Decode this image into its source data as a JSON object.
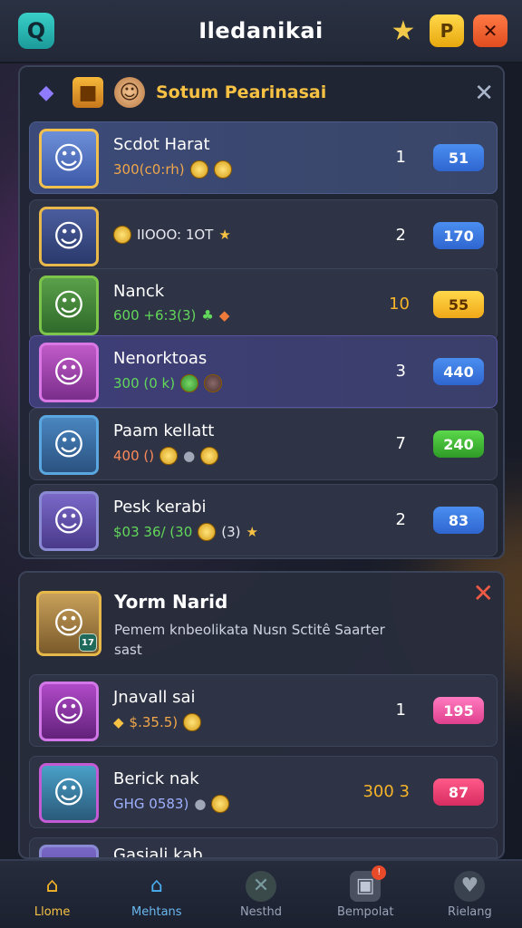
{
  "header": {
    "title": "Iledanikai",
    "logo_glyph": "Q",
    "coin_glyph": "P",
    "close_glyph": "✕"
  },
  "panel_a": {
    "title": "Sotum Pearinasai",
    "rows": [
      {
        "name": "Scdot Harat",
        "sub": "300(c0:rh)",
        "rank": "1",
        "score": "51"
      },
      {
        "name": "",
        "sub": "IIOOO: 1OT",
        "rank": "2",
        "score": "170"
      },
      {
        "name": "Nanck",
        "sub": "600 +6:3(3)",
        "rank": "10",
        "score": "55"
      },
      {
        "name": "Nenorktoas",
        "sub": "300 (0 k)",
        "rank": "3",
        "score": "440"
      },
      {
        "name": "Paam kellatt",
        "sub": "400 ()",
        "rank": "7",
        "score": "240"
      },
      {
        "name": "Pesk kerabi",
        "sub": "$03 36/ (30",
        "rank": "2",
        "score": "83"
      }
    ]
  },
  "panel_b": {
    "featured_title": "Yorm Narid",
    "featured_desc": "Pemem knbeolikata Nusn Sctitê Saarter sast",
    "featured_badge": "17",
    "rows": [
      {
        "name": "Jnavall sai",
        "sub": "$.35.5)",
        "rank": "1",
        "score": "195"
      },
      {
        "name": "Berick nak",
        "sub": "GHG 0583)",
        "rank": "300 3",
        "score": "87"
      },
      {
        "name": "Gasiali kab",
        "sub": "",
        "rank": "",
        "score": ""
      }
    ]
  },
  "nav": [
    {
      "label": "Llome"
    },
    {
      "label": "Mehtans"
    },
    {
      "label": "Nesthd"
    },
    {
      "label": "Bempolat"
    },
    {
      "label": "Rielang"
    }
  ],
  "colors": {
    "accent": "#f7c244",
    "panel": "#202534",
    "background": "#1a1e2c"
  },
  "icons": [
    "app-logo-icon",
    "star-icon",
    "coin-icon",
    "close-icon",
    "gem-icon",
    "chest-icon",
    "home-icon",
    "members-icon",
    "nesthd-icon",
    "bempolat-icon",
    "rielang-icon"
  ]
}
